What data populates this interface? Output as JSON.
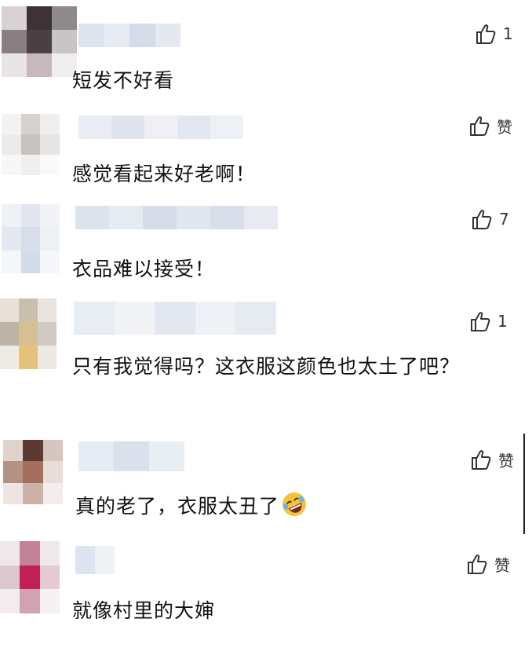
{
  "comments": [
    {
      "text": "短发不好看",
      "likes": "1"
    },
    {
      "text": "感觉看起来好老啊！",
      "likes": "赞"
    },
    {
      "text": "衣品难以接受！",
      "likes": "7"
    },
    {
      "text": "只有我觉得吗？这衣服这颜色也太土了吧？",
      "likes": "1"
    },
    {
      "text": "真的老了，衣服太丑了",
      "likes": "赞",
      "emoji": "rolling-on-floor-laughing-emoji"
    },
    {
      "text": "就像村里的大婶",
      "likes": "赞"
    }
  ],
  "colors": {
    "text": "#111111",
    "like": "#333333",
    "blur_light": "#e8ecf2"
  }
}
